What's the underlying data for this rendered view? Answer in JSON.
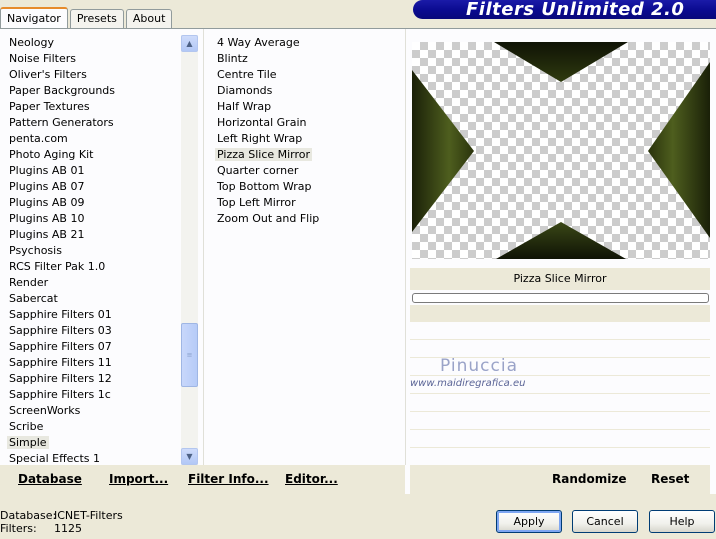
{
  "app": {
    "title": "Filters Unlimited 2.0"
  },
  "tabs": [
    {
      "label": "Navigator",
      "active": true
    },
    {
      "label": "Presets",
      "active": false
    },
    {
      "label": "About",
      "active": false
    }
  ],
  "categories": {
    "items": [
      "Neology",
      "Noise Filters",
      "Oliver's Filters",
      "Paper Backgrounds",
      "Paper Textures",
      "Pattern Generators",
      "penta.com",
      "Photo Aging Kit",
      "Plugins AB 01",
      "Plugins AB 07",
      "Plugins AB 09",
      "Plugins AB 10",
      "Plugins AB 21",
      "Psychosis",
      "RCS Filter Pak 1.0",
      "Render",
      "Sabercat",
      "Sapphire Filters 01",
      "Sapphire Filters 03",
      "Sapphire Filters 07",
      "Sapphire Filters 11",
      "Sapphire Filters 12",
      "Sapphire Filters 1c",
      "ScreenWorks",
      "Scribe",
      "Simple",
      "Special Effects 1"
    ],
    "selected": "Simple"
  },
  "filters": {
    "items": [
      "4 Way Average",
      "Blintz",
      "Centre Tile",
      "Diamonds",
      "Half Wrap",
      "Horizontal Grain",
      "Left Right Wrap",
      "Pizza Slice Mirror",
      "Quarter corner",
      "Top Bottom Wrap",
      "Top Left Mirror",
      "Zoom Out and Flip"
    ],
    "selected": "Pizza Slice Mirror"
  },
  "preview": {
    "filter_name": "Pizza Slice Mirror",
    "colors": {
      "dark": "#1a1f0a",
      "mid": "#3a4414",
      "light": "#5a6b26"
    }
  },
  "watermark": {
    "name": "Pinuccia",
    "url": "www.maidiregrafica.eu"
  },
  "left_buttons": {
    "database": "Database",
    "import": "Import...",
    "filter_info": "Filter Info...",
    "editor": "Editor..."
  },
  "right_buttons": {
    "randomize": "Randomize",
    "reset": "Reset"
  },
  "status": {
    "database_label": "Database:",
    "database_value": "ICNET-Filters",
    "filters_label": "Filters:",
    "filters_value": "1125"
  },
  "dialog_buttons": {
    "apply": "Apply",
    "cancel": "Cancel",
    "help": "Help"
  },
  "icons": {
    "scroll_up": "scroll-up-arrow-icon",
    "scroll_down": "scroll-down-arrow-icon",
    "scroll_grip": "scroll-grip-icon"
  }
}
